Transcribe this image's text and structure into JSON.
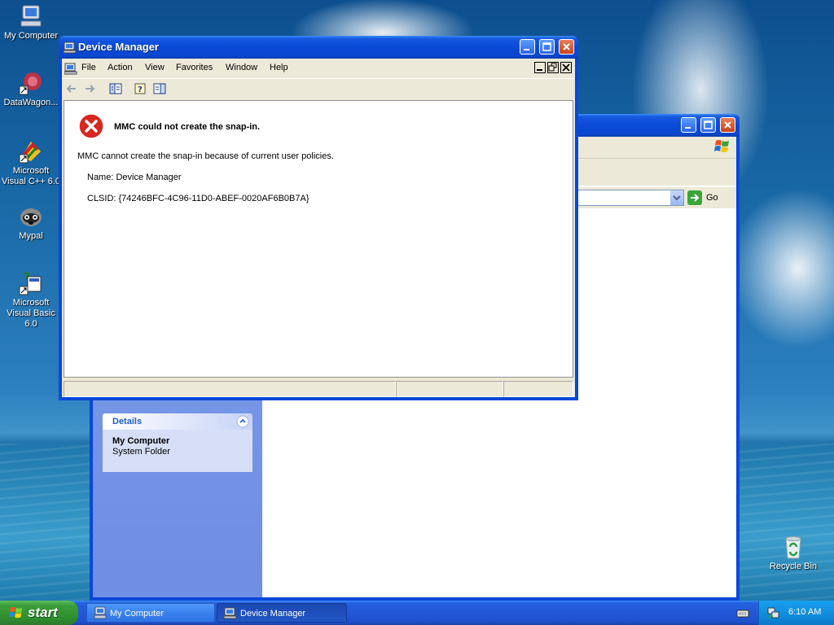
{
  "desktop": {
    "icons": [
      {
        "label": "My Computer"
      },
      {
        "label": "DataWagon..."
      },
      {
        "label": "Microsoft Visual C++ 6.0"
      },
      {
        "label": "Mypal"
      },
      {
        "label": "Microsoft Visual Basic 6.0"
      },
      {
        "label": "Recycle Bin"
      }
    ]
  },
  "background_window": {
    "address_go": "Go",
    "details_header": "Details",
    "details_name": "My Computer",
    "details_type": "System Folder"
  },
  "device_manager": {
    "title": "Device Manager",
    "menu": [
      "File",
      "Action",
      "View",
      "Favorites",
      "Window",
      "Help"
    ],
    "error": {
      "heading": "MMC could not create the snap-in.",
      "message": "MMC cannot create the snap-in because of current user policies.",
      "name_line": "Name: Device Manager",
      "clsid_line": "CLSID: {74246BFC-4C96-11D0-ABEF-0020AF6B0B7A}"
    }
  },
  "taskbar": {
    "start_label": "start",
    "buttons": [
      {
        "label": "My Computer",
        "active": false
      },
      {
        "label": "Device Manager",
        "active": true
      }
    ],
    "clock": "6:10 AM"
  },
  "colors": {
    "title_blue": "#0a4ad6",
    "taskbar_blue": "#2458d8",
    "start_green": "#3c9d3c",
    "error_red": "#d8271e"
  }
}
